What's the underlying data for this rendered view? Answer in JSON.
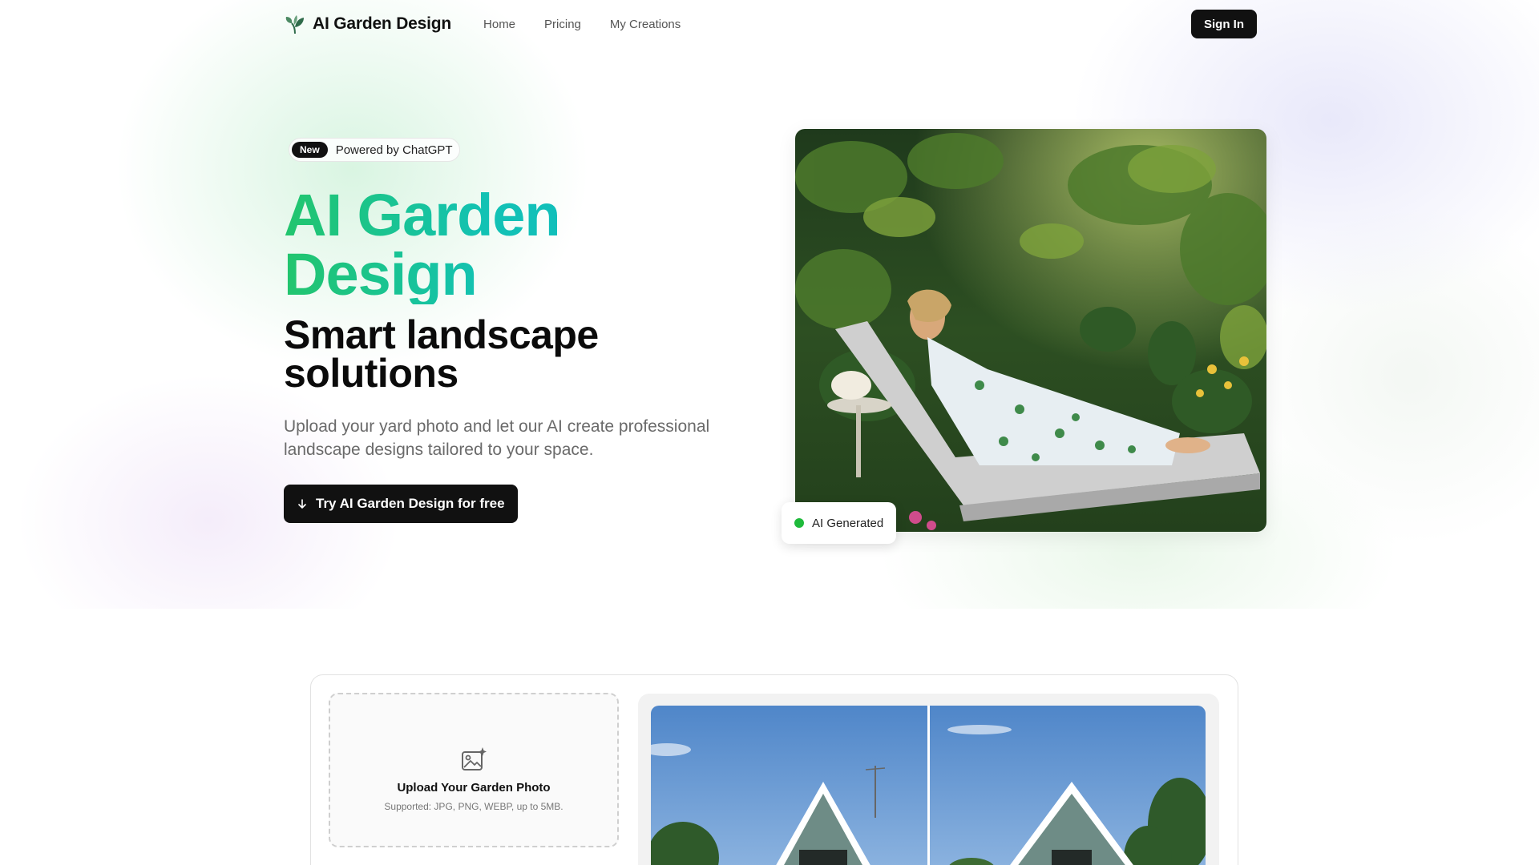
{
  "nav": {
    "brand": "AI Garden Design",
    "links": [
      "Home",
      "Pricing",
      "My Creations"
    ],
    "sign_in": "Sign In"
  },
  "hero": {
    "badge_new": "New",
    "badge_text": "Powered by ChatGPT",
    "title_line1": "AI Garden",
    "title_line2": "Design",
    "subtitle_line1": "Smart landscape",
    "subtitle_line2": "solutions",
    "description": "Upload your yard photo and let our AI create professional landscape designs tailored to your space.",
    "cta": "Try AI Garden Design for free",
    "image_badge": "AI Generated"
  },
  "tool": {
    "upload_title": "Upload Your Garden Photo",
    "upload_sub": "Supported: JPG, PNG, WEBP, up to 5MB."
  },
  "colors": {
    "accent_green": "#22c56d",
    "accent_teal": "#0fb8c9",
    "dark": "#111111",
    "status_green": "#1fba3b"
  },
  "icons": {
    "logo": "plant-leaf-icon",
    "cta": "arrow-down-icon",
    "upload": "image-sparkle-icon"
  }
}
